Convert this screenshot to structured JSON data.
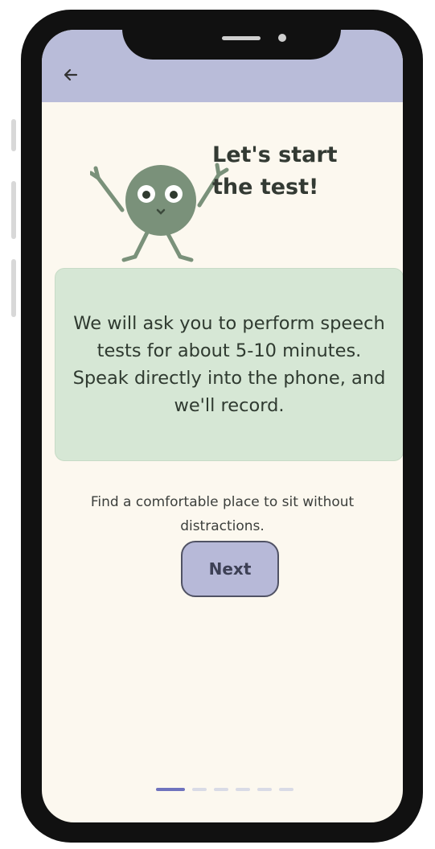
{
  "heading": {
    "line1": "Let's start",
    "line2": "the test!"
  },
  "info_card": {
    "text": "We will ask you to perform speech tests for about 5-10 minutes. Speak directly into the phone, and we'll record."
  },
  "tip_text": "Find a comfortable place to sit without distractions.",
  "next_button": {
    "label": "Next"
  },
  "icons": {
    "back": "arrow-left-icon",
    "mascot": "green-ball-mascot"
  },
  "pager": {
    "total": 6,
    "active_index": 0
  },
  "colors": {
    "topbar": "#b9bcd9",
    "background": "#fcf8ef",
    "card": "#d6e7d5",
    "mascot": "#7a917a",
    "button": "#b7b9d8",
    "active_dot": "#6f73be"
  }
}
